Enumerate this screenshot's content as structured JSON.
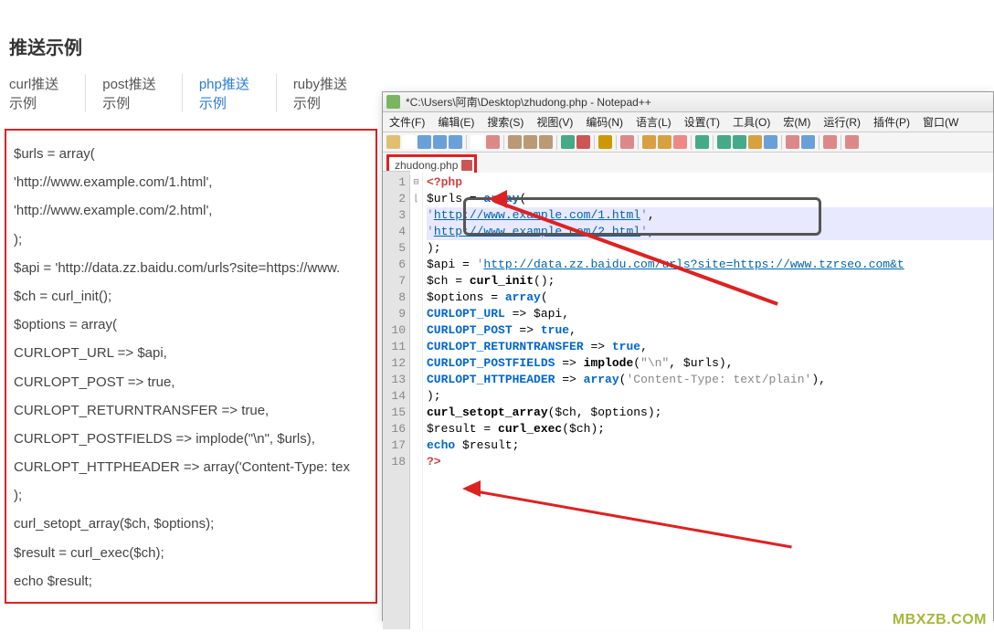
{
  "page_title": "推送示例",
  "tabs": [
    "curl推送示例",
    "post推送示例",
    "php推送示例",
    "ruby推送示例"
  ],
  "active_tab_index": 2,
  "codebox_lines": [
    "$urls = array(",
    "    'http://www.example.com/1.html',",
    "    'http://www.example.com/2.html',",
    ");",
    "$api = 'http://data.zz.baidu.com/urls?site=https://www.",
    "$ch = curl_init();",
    "$options =  array(",
    "    CURLOPT_URL => $api,",
    "    CURLOPT_POST => true,",
    "    CURLOPT_RETURNTRANSFER => true,",
    "    CURLOPT_POSTFIELDS => implode(\"\\n\", $urls),",
    "    CURLOPT_HTTPHEADER => array('Content-Type: tex",
    ");",
    "curl_setopt_array($ch, $options);",
    "$result = curl_exec($ch);",
    "echo $result;"
  ],
  "npp": {
    "title": "*C:\\Users\\阿南\\Desktop\\zhudong.php - Notepad++",
    "menus": [
      "文件(F)",
      "编辑(E)",
      "搜索(S)",
      "视图(V)",
      "编码(N)",
      "语言(L)",
      "设置(T)",
      "工具(O)",
      "宏(M)",
      "运行(R)",
      "插件(P)",
      "窗口(W"
    ],
    "filetab": "zhudong.php",
    "line_numbers": [
      "1",
      "2",
      "3",
      "4",
      "5",
      "6",
      "7",
      "8",
      "9",
      "10",
      "11",
      "12",
      "13",
      "14",
      "15",
      "16",
      "17",
      "18"
    ],
    "fold_marks": [
      "⊟",
      "",
      "",
      "",
      "",
      "",
      "",
      "",
      "",
      "",
      "",
      "",
      "",
      "",
      "",
      "",
      "",
      "⌊"
    ],
    "code_html": [
      "<span class='k-php'>&lt;?php</span>",
      "$urls = <span class='k-kw'>array</span>(",
      "    <span class='k-str'>'</span><span class='k-link'>http://www.example.com/1.html</span><span class='k-str'>'</span>,",
      "    <span class='k-str'>'</span><span class='k-link'>http://www.example.com/2.html</span><span class='k-str'>'</span>,",
      ");",
      "$api = <span class='k-str'>'</span><span class='k-link'>http://data.zz.baidu.com/urls?site=https://www.tzrseo.com&t</span>",
      "$ch = <span class='k-func'>curl_init</span>();",
      "$options =  <span class='k-kw'>array</span>(",
      "    <span class='k-const'>CURLOPT_URL</span> =&gt; $api,",
      "    <span class='k-const'>CURLOPT_POST</span> =&gt; <span class='k-kw'>true</span>,",
      "    <span class='k-const'>CURLOPT_RETURNTRANSFER</span> =&gt; <span class='k-kw'>true</span>,",
      "    <span class='k-const'>CURLOPT_POSTFIELDS</span> =&gt; <span class='k-func'>implode</span>(<span class='k-str'>\"\\n\"</span>, $urls),",
      "    <span class='k-const'>CURLOPT_HTTPHEADER</span> =&gt; <span class='k-kw'>array</span>(<span class='k-str'>'Content-Type: text/plain'</span>),",
      ");",
      "<span class='k-func'>curl_setopt_array</span>($ch, $options);",
      "$result = <span class='k-func'>curl_exec</span>($ch);",
      "<span class='k-kw'>echo</span> $result;",
      "<span class='k-php'>?&gt;</span>"
    ],
    "highlighted_lines": [
      2,
      3
    ]
  },
  "toolbar_colors": [
    "#e0c070",
    "#fff",
    "#6aa0d8",
    "#6aa0d8",
    "#6aa0d8",
    "sep",
    "#fff",
    "#d88",
    "sep",
    "#b97",
    "#b97",
    "#b97",
    "sep",
    "#4a8",
    "#c55",
    "sep",
    "#c90",
    "sep",
    "#d88",
    "sep",
    "#d8a040",
    "#d8a040",
    "#e88",
    "sep",
    "#4a8",
    "sep",
    "#4a8",
    "#4a8",
    "#d8a040",
    "#6aa0d8",
    "sep",
    "#d88",
    "#6aa0d8",
    "sep",
    "#d88",
    "sep",
    "#d88"
  ],
  "watermark": "MBXZB.COM"
}
